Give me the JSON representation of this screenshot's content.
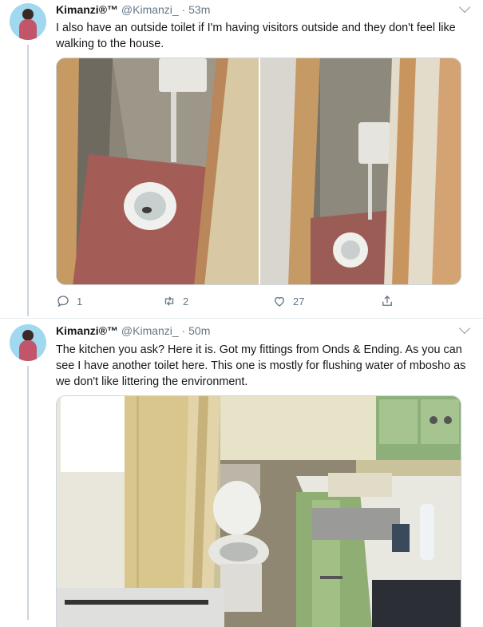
{
  "tweets": [
    {
      "name": "Kimanzi",
      "badge": "®™",
      "handle": "@Kimanzi_",
      "time": "· 53m",
      "text": "I also have an outside toilet if I'm having visitors outside and they don't feel like walking to the house.",
      "replies": "1",
      "retweets": "2",
      "likes": "27"
    },
    {
      "name": "Kimanzi",
      "badge": "®™",
      "handle": "@Kimanzi_",
      "time": "· 50m",
      "text": "The kitchen you ask? Here it is. Got my fittings from Onds & Ending. As you can see I have another toilet here. This one is mostly for flushing water of mbosho as we don't like littering the environment."
    }
  ],
  "colors": {
    "text": "#14171a",
    "secondary": "#657786",
    "border": "#ccd6dd"
  },
  "icons": [
    "reply-icon",
    "retweet-icon",
    "like-icon",
    "share-icon",
    "chevron-down-icon"
  ]
}
